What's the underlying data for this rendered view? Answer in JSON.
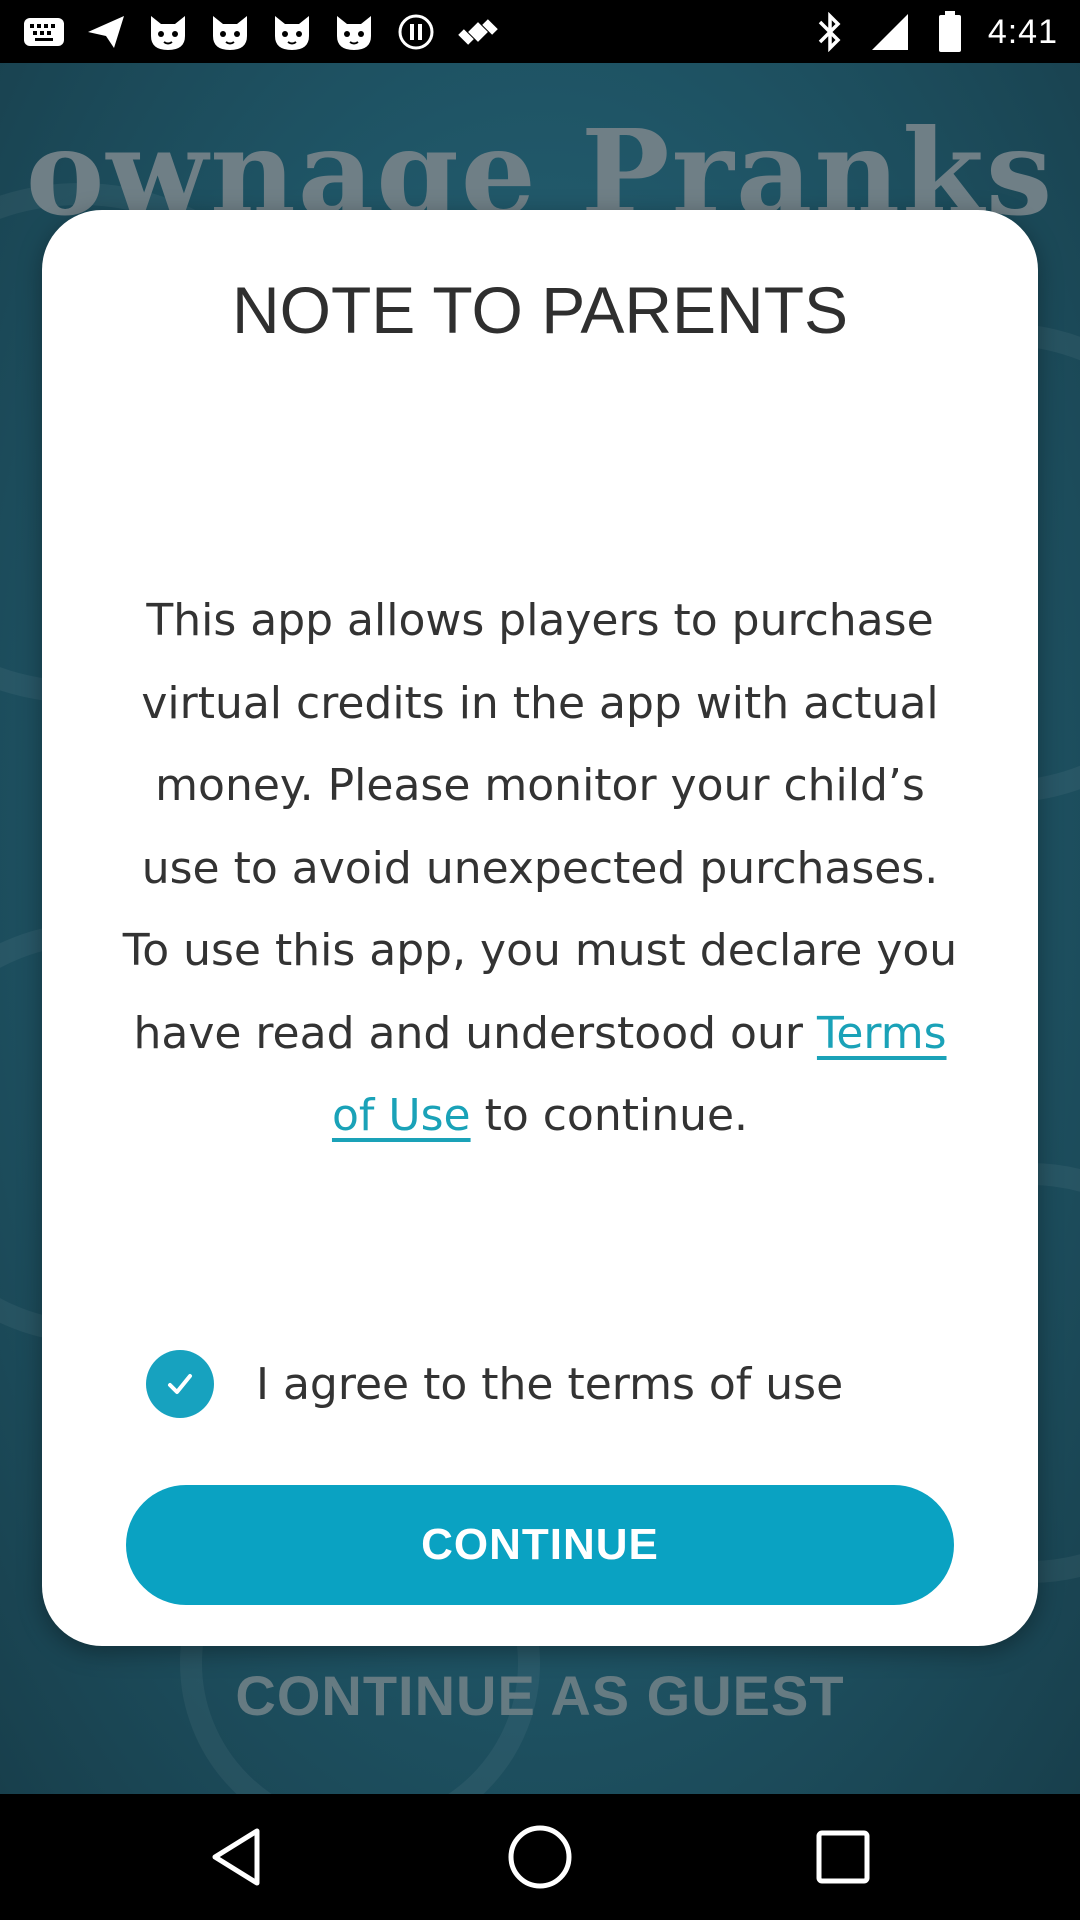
{
  "status_bar": {
    "time": "4:41",
    "left_icons": [
      "message-icon",
      "send-icon",
      "cat-face-icon",
      "cat-face-icon",
      "cat-face-icon",
      "cat-face-icon",
      "record-icon",
      "fake-gps-icon"
    ],
    "right_icons": [
      "bluetooth-icon",
      "signal-icon",
      "battery-icon"
    ]
  },
  "background": {
    "logo_text": "ownage Pranks",
    "guest_label": "CONTINUE AS GUEST"
  },
  "modal": {
    "title": "NOTE TO PARENTS",
    "body_text": "This app allows players to purchase virtual credits in the app with actual money. Please monitor your child’s use to avoid unexpected purchases. To use this app, you must declare you have read and understood our ",
    "terms_link": "Terms of Use",
    "body_suffix": " to continue.",
    "agree_label": "I agree to the terms of use",
    "agree_checked": true,
    "continue_label": "CONTINUE"
  },
  "colors": {
    "accent": "#0aa2c2",
    "link": "#1aa2b8",
    "background": "#1f5566"
  },
  "nav_bar": {
    "buttons": [
      "back-icon",
      "home-icon",
      "recents-icon"
    ]
  }
}
